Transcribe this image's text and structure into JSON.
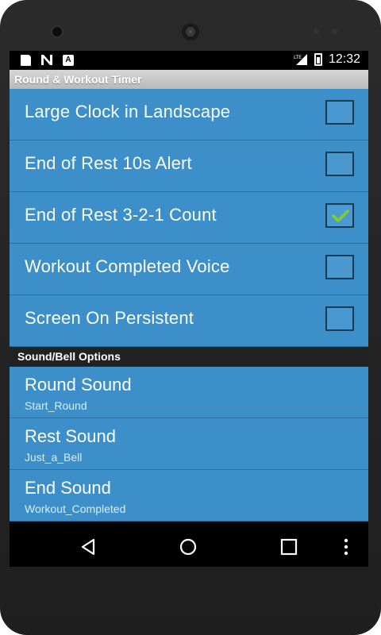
{
  "status_bar": {
    "time": "12:32",
    "signal_label": "LTE",
    "icons": [
      "sd-card-icon",
      "n-icon",
      "a-icon",
      "lte-signal-icon",
      "battery-icon"
    ]
  },
  "header": {
    "title": "Round & Workout Timer"
  },
  "preferences": [
    {
      "label": "Large Clock in Landscape",
      "checked": false
    },
    {
      "label": "End of Rest 10s Alert",
      "checked": false
    },
    {
      "label": "End of Rest 3-2-1 Count",
      "checked": true
    },
    {
      "label": "Workout Completed Voice",
      "checked": false
    },
    {
      "label": "Screen On Persistent",
      "checked": false
    }
  ],
  "sound_section": {
    "title": "Sound/Bell Options",
    "items": [
      {
        "title": "Round Sound",
        "value": "Start_Round"
      },
      {
        "title": "Rest Sound",
        "value": "Just_a_Bell"
      },
      {
        "title": "End Sound",
        "value": "Workout_Completed"
      }
    ]
  },
  "nav_bar": {
    "icons": [
      "back-icon",
      "home-icon",
      "recents-icon",
      "overflow-menu-icon"
    ]
  },
  "colors": {
    "item_bg": "#3c8fc9",
    "section_bg": "#222222",
    "check": "#7ed321"
  }
}
